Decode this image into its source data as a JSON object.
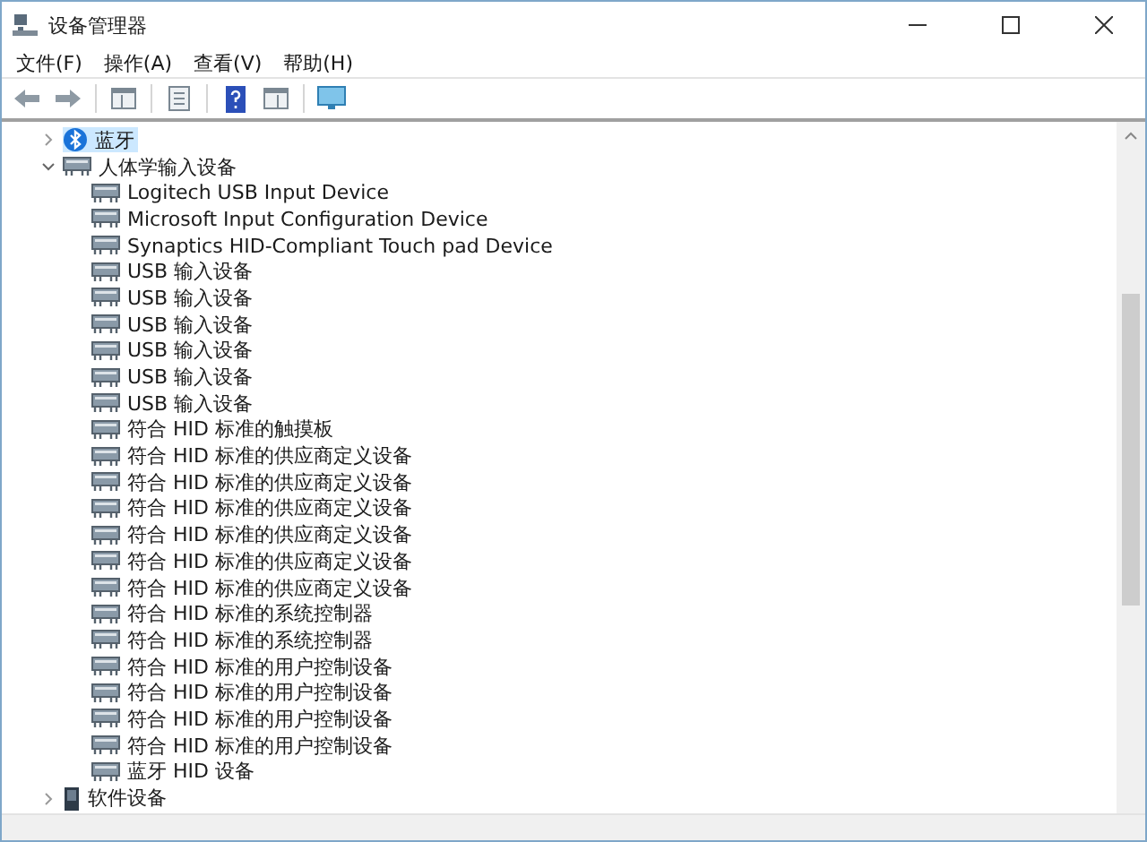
{
  "window": {
    "title": "设备管理器"
  },
  "menu": [
    "文件(F)",
    "操作(A)",
    "查看(V)",
    "帮助(H)"
  ],
  "tree": [
    {
      "label": "蓝牙",
      "kind": "bluetooth",
      "expanded": false,
      "selected": true
    },
    {
      "label": "人体学输入设备",
      "kind": "hid",
      "expanded": true,
      "selected": false,
      "children": [
        {
          "label": "Logitech USB Input Device",
          "kind": "hid",
          "selected": false
        },
        {
          "label": "Microsoft Input Configuration Device",
          "kind": "hid",
          "selected": false
        },
        {
          "label": "Synaptics HID-Compliant Touch pad Device",
          "kind": "hid",
          "selected": false
        },
        {
          "label": "USB 输入设备",
          "kind": "hid",
          "selected": false
        },
        {
          "label": "USB 输入设备",
          "kind": "hid",
          "selected": false
        },
        {
          "label": "USB 输入设备",
          "kind": "hid",
          "selected": false
        },
        {
          "label": "USB 输入设备",
          "kind": "hid",
          "selected": false
        },
        {
          "label": "USB 输入设备",
          "kind": "hid",
          "selected": false
        },
        {
          "label": "USB 输入设备",
          "kind": "hid",
          "selected": false
        },
        {
          "label": "符合 HID 标准的触摸板",
          "kind": "hid",
          "selected": false
        },
        {
          "label": "符合 HID 标准的供应商定义设备",
          "kind": "hid",
          "selected": false
        },
        {
          "label": "符合 HID 标准的供应商定义设备",
          "kind": "hid",
          "selected": false
        },
        {
          "label": "符合 HID 标准的供应商定义设备",
          "kind": "hid",
          "selected": false
        },
        {
          "label": "符合 HID 标准的供应商定义设备",
          "kind": "hid",
          "selected": false
        },
        {
          "label": "符合 HID 标准的供应商定义设备",
          "kind": "hid",
          "selected": false
        },
        {
          "label": "符合 HID 标准的供应商定义设备",
          "kind": "hid",
          "selected": false
        },
        {
          "label": "符合 HID 标准的系统控制器",
          "kind": "hid",
          "selected": false
        },
        {
          "label": "符合 HID 标准的系统控制器",
          "kind": "hid",
          "selected": false
        },
        {
          "label": "符合 HID 标准的用户控制设备",
          "kind": "hid",
          "selected": false
        },
        {
          "label": "符合 HID 标准的用户控制设备",
          "kind": "hid",
          "selected": false
        },
        {
          "label": "符合 HID 标准的用户控制设备",
          "kind": "hid",
          "selected": false
        },
        {
          "label": "符合 HID 标准的用户控制设备",
          "kind": "hid",
          "selected": false
        },
        {
          "label": "蓝牙 HID 设备",
          "kind": "hid",
          "selected": false
        }
      ]
    },
    {
      "label": "软件设备",
      "kind": "software",
      "expanded": false,
      "selected": false
    }
  ]
}
